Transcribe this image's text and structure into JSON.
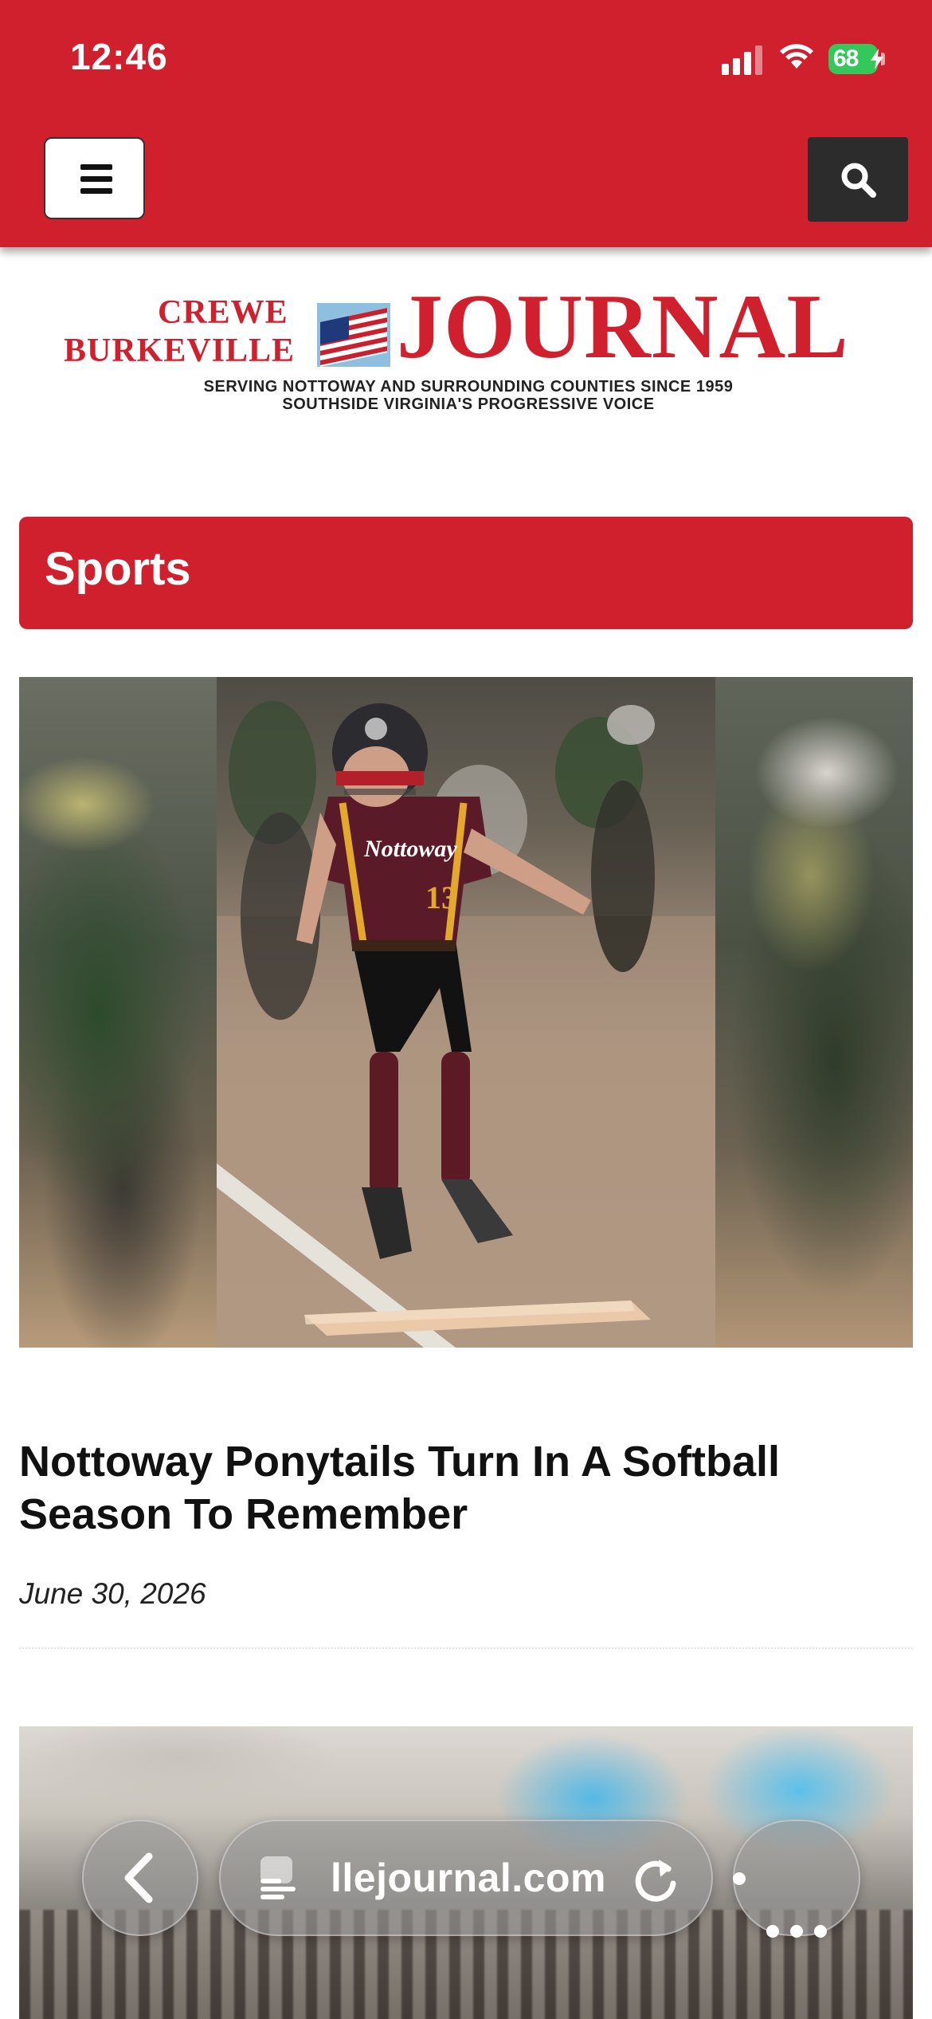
{
  "status_bar": {
    "time": "12:46",
    "battery": "68",
    "icons": [
      "cellular-signal-icon",
      "wifi-icon",
      "battery-icon",
      "charging-bolt-icon"
    ]
  },
  "header": {
    "menu_icon": "hamburger-menu-icon",
    "search_icon": "search-icon",
    "brand_color": "#d0202e",
    "search_button_color": "#2c2c2c"
  },
  "logo": {
    "line1": "CREWE",
    "line2": "BURKEVILLE",
    "wordmark": "JOURNAL",
    "tagline1": "SERVING NOTTOWAY AND SURROUNDING COUNTIES SINCE 1959",
    "tagline2": "SOUTHSIDE VIRGINIA'S PROGRESSIVE VOICE"
  },
  "section": {
    "title": "Sports"
  },
  "articles": [
    {
      "title": "Nottoway Ponytails Turn In A Softball Season To Remember",
      "date": "June 30, 2026",
      "jersey_text": "Nottoway",
      "jersey_number": "13"
    }
  ],
  "browser_bar": {
    "url": "llejournal.com",
    "back_icon": "chevron-left-icon",
    "page_icon": "page-menu-icon",
    "reload_icon": "reload-icon",
    "more_icon": "more-dots-icon"
  }
}
